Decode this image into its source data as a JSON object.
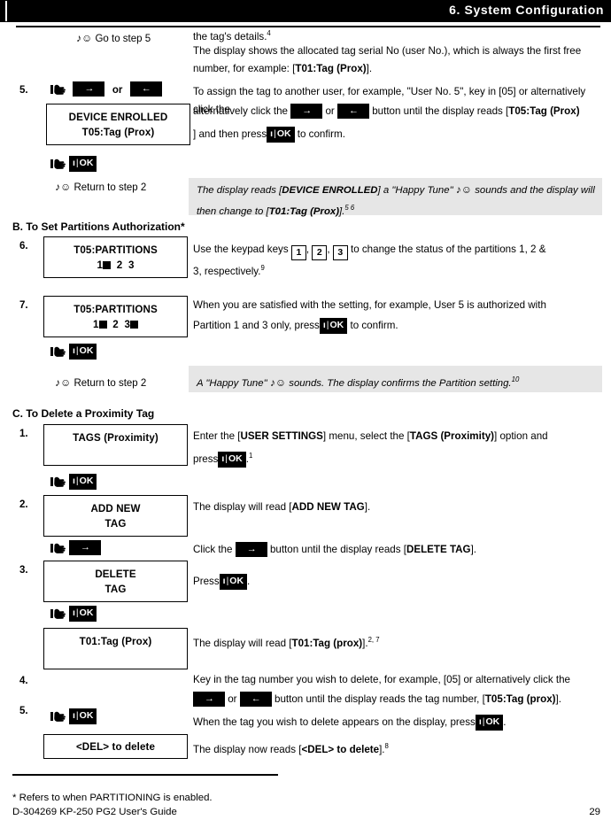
{
  "header": {
    "chapter_title": "6. System Configuration"
  },
  "icons": {
    "hand": "pointing-hand-icon",
    "music_note": "♪",
    "smiley": "☺",
    "arrow_right": "→",
    "arrow_left": "←"
  },
  "top_block": {
    "cue_goto": "Go to step 5",
    "text_1": "the tag's details.",
    "text_1_fn": "4",
    "text_2": "The display shows the allocated tag serial No (user No.), which is always the first free number, for example: [",
    "text_2_bold": "T01:Tag (Prox)",
    "text_2_end": "]."
  },
  "step5_enroll": {
    "num": "5.",
    "or_label": "or",
    "lcd_line1": "DEVICE ENROLLED",
    "lcd_line2": "T05:Tag (Prox)",
    "ok_label": "OK",
    "ok_info": "ı",
    "body_a": "To assign the tag to another user, for example, \"User No. 5\", key in [05] or alternatively click the",
    "body_b": "or",
    "body_c": "button until the display reads [",
    "body_bold": "T05:Tag (Prox)",
    "body_d": "] and then press",
    "body_e": "to confirm.",
    "cue_return": "Return to step 2",
    "note_a": "The display reads [",
    "note_bold1": "DEVICE ENROLLED",
    "note_b": "] a \"Happy Tune\"",
    "note_c": "sounds and the display will then change to [",
    "note_bold2": "T01:Tag (Prox)",
    "note_d": "].",
    "note_fn": "5 6"
  },
  "section_b": {
    "heading": "B. To Set Partitions Authorization*",
    "step6": {
      "num": "6.",
      "lcd_line1": "T05:PARTITIONS",
      "partitions": [
        {
          "label": "1",
          "on": true
        },
        {
          "label": "2",
          "on": false
        },
        {
          "label": "3",
          "on": false
        }
      ],
      "body_a": "Use the keypad keys",
      "key1": "1",
      "key2": "2",
      "key3": "3",
      "body_b": "to change the status of the partitions 1, 2 & 3, respectively.",
      "body_fn": "9"
    },
    "step7": {
      "num": "7.",
      "lcd_line1": "T05:PARTITIONS",
      "partitions": [
        {
          "label": "1",
          "on": true
        },
        {
          "label": "2",
          "on": false
        },
        {
          "label": "3",
          "on": true
        }
      ],
      "body_a": "When you are satisfied with the setting, for example, User 5 is authorized with Partition 1 and 3 only, press",
      "body_b": "to confirm.",
      "ok_label": "OK",
      "cue_return": "Return to step 2",
      "note_a": "A \"Happy Tune\"",
      "note_b": "sounds. The display confirms the Partition setting.",
      "note_fn": "10"
    }
  },
  "section_c": {
    "heading": "C. To Delete a Proximity Tag",
    "step1": {
      "num": "1.",
      "lcd_line1": "TAGS (Proximity)",
      "body_a": "Enter the [",
      "body_bold1": "USER SETTINGS",
      "body_b": "] menu, select the [",
      "body_bold2": "TAGS (Proximity)",
      "body_c": "] option and press",
      "body_d": ".",
      "body_fn": "1",
      "ok_label": "OK"
    },
    "step2": {
      "num": "2.",
      "lcd_line1": "ADD NEW",
      "lcd_line2": "TAG",
      "body_a": "The display will read [",
      "body_bold": "ADD NEW TAG",
      "body_b": "].",
      "click_a": "Click the",
      "click_b": "button until the display reads [",
      "click_bold": "DELETE TAG",
      "click_c": "]."
    },
    "step3": {
      "num": "3.",
      "lcd_line1": "DELETE",
      "lcd_line2": "TAG",
      "body_a": "Press",
      "body_b": ".",
      "ok_label": "OK",
      "lcd2_line1": "T01:Tag (Prox)",
      "body2_a": "The display will read [",
      "body2_bold": "T01:Tag (prox)",
      "body2_b": "].",
      "body2_fn": "2, 7"
    },
    "step4": {
      "num": "4.",
      "body_a": "Key in the tag number you wish to delete, for example, [05] or alternatively click the",
      "body_b": "or",
      "body_c": "button until the display reads the tag number, [",
      "body_bold": "T05:Tag (prox)",
      "body_d": "]."
    },
    "step5": {
      "num": "5.",
      "ok_label": "OK",
      "body_a": "When the tag you wish to delete appears on the display, press",
      "body_b": ".",
      "lcd_line1": "<DEL> to delete",
      "body2_a": "The display now reads [",
      "body2_bold": "<DEL> to delete",
      "body2_b": "].",
      "body2_fn": "8"
    }
  },
  "footer": {
    "footnote": "* Refers to when PARTITIONING is enabled.",
    "doc_id": "D-304269 KP-250 PG2 User's Guide",
    "page_number": "29"
  }
}
